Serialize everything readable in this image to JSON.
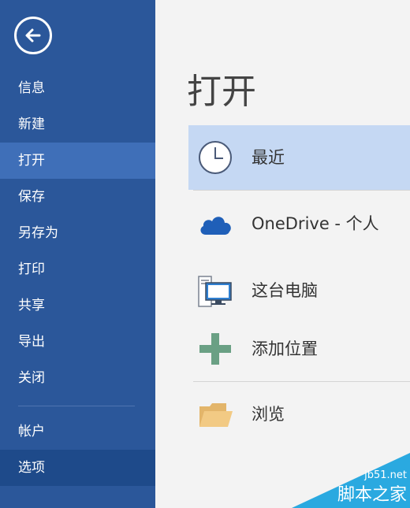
{
  "sidebar": {
    "items": [
      {
        "label": "信息"
      },
      {
        "label": "新建"
      },
      {
        "label": "打开"
      },
      {
        "label": "保存"
      },
      {
        "label": "另存为"
      },
      {
        "label": "打印"
      },
      {
        "label": "共享"
      },
      {
        "label": "导出"
      },
      {
        "label": "关闭"
      },
      {
        "label": "帐户"
      },
      {
        "label": "选项"
      }
    ]
  },
  "main": {
    "title": "打开",
    "locations": [
      {
        "label": "最近",
        "icon": "clock-icon"
      },
      {
        "label": "OneDrive - 个人",
        "icon": "cloud-icon"
      },
      {
        "label": "这台电脑",
        "icon": "computer-icon"
      },
      {
        "label": "添加位置",
        "icon": "plus-icon"
      },
      {
        "label": "浏览",
        "icon": "folder-icon"
      }
    ]
  },
  "watermark": {
    "site": "jb51.net",
    "name": "脚本之家"
  },
  "colors": {
    "sidebar_bg": "#2b579a",
    "sidebar_active": "#3f6fb8",
    "selected_bg": "#c5d8f3"
  }
}
